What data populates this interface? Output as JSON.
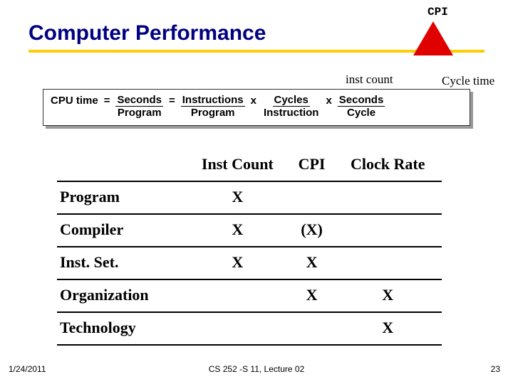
{
  "title": "Computer Performance",
  "labels": {
    "cpi": "CPI",
    "inst_count": "inst count",
    "cycle_time": "Cycle time"
  },
  "formula": {
    "cpu_time": "CPU time",
    "eq1": "=",
    "f1_top": "Seconds",
    "f1_bot": "Program",
    "eq2": "=",
    "f2_top": "Instructions",
    "f2_bot": "Program",
    "x1": "x",
    "f3_top": "Cycles",
    "f3_bot": "Instruction",
    "x2": "x",
    "f4_top": "Seconds",
    "f4_bot": "Cycle"
  },
  "table": {
    "headers": [
      "",
      "Inst Count",
      "CPI",
      "Clock Rate"
    ],
    "rows": [
      {
        "label": "Program",
        "c1": "X",
        "c2": "",
        "c3": ""
      },
      {
        "label": "Compiler",
        "c1": "X",
        "c2": "(X)",
        "c3": ""
      },
      {
        "label": "Inst. Set.",
        "c1": "X",
        "c2": "X",
        "c3": ""
      },
      {
        "label": "Organization",
        "c1": "",
        "c2": "X",
        "c3": "X"
      },
      {
        "label": "Technology",
        "c1": "",
        "c2": "",
        "c3": "X"
      }
    ]
  },
  "footer": {
    "date": "1/24/2011",
    "center": "CS 252 -S 11, Lecture 02",
    "page": "23"
  }
}
